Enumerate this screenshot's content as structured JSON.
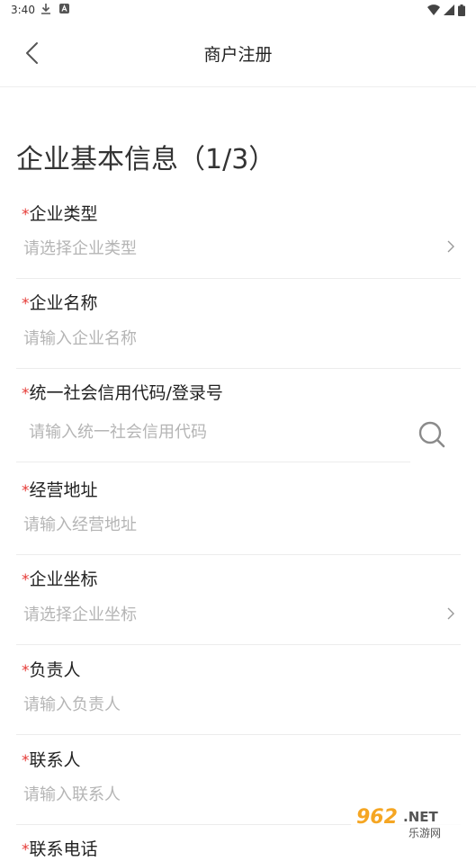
{
  "status_bar": {
    "time": "3:40"
  },
  "header": {
    "title": "商户注册",
    "back_icon": "chevron-left-icon"
  },
  "section": {
    "title": "企业基本信息（1/3）"
  },
  "required_mark": "*",
  "fields": [
    {
      "label": "企业类型",
      "placeholder": "请选择企业类型",
      "type": "select"
    },
    {
      "label": "企业名称",
      "placeholder": "请输入企业名称",
      "type": "text"
    },
    {
      "label": "统一社会信用代码/登录号",
      "placeholder": "请输入统一社会信用代码",
      "type": "search"
    },
    {
      "label": "经营地址",
      "placeholder": "请输入经营地址",
      "type": "text"
    },
    {
      "label": "企业坐标",
      "placeholder": "请选择企业坐标",
      "type": "select"
    },
    {
      "label": "负责人",
      "placeholder": "请输入负责人",
      "type": "text"
    },
    {
      "label": "联系人",
      "placeholder": "请输入联系人",
      "type": "text"
    },
    {
      "label": "联系电话",
      "type": "text"
    }
  ],
  "watermark": {
    "text": "962.NET",
    "subtext": "乐游网"
  },
  "colors": {
    "required": "#e53935",
    "placeholder": "#b5b5b5",
    "divider": "#ececec",
    "watermark": "#f5a623"
  }
}
